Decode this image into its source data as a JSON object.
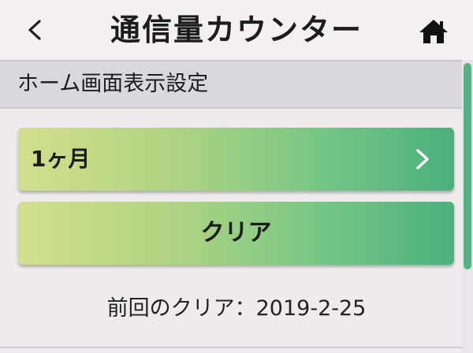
{
  "header": {
    "title": "通信量カウンター",
    "back_icon": "chevron-left-icon",
    "home_icon": "home-icon"
  },
  "section": {
    "label": "ホーム画面表示設定"
  },
  "period_button": {
    "label": "1ヶ月",
    "icon": "chevron-right-icon"
  },
  "clear_button": {
    "label": "クリア"
  },
  "last_clear": {
    "label": "前回のクリア：",
    "date": "2019-2-25"
  },
  "colors": {
    "accent_green": "#4bb07b",
    "accent_lime": "#d3df8c",
    "section_bg": "#dad7dd",
    "background": "#eeeaee"
  }
}
